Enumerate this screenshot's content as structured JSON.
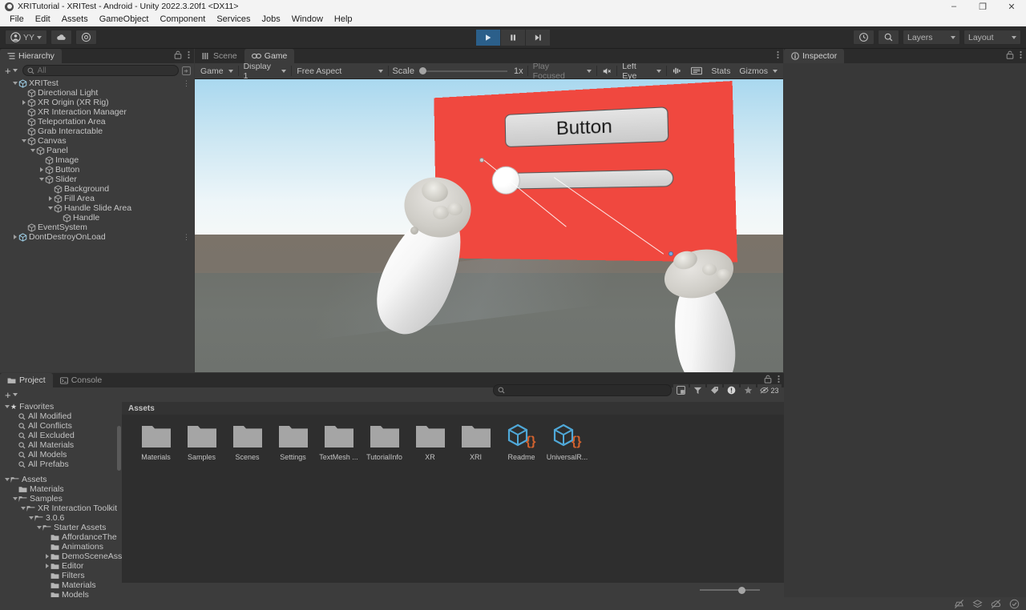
{
  "window": {
    "title": "XRITutorial - XRITest - Android - Unity 2022.3.20f1 <DX11>",
    "minimize": "–",
    "maximize": "❐",
    "close": "✕"
  },
  "menubar": {
    "items": [
      "File",
      "Edit",
      "Assets",
      "GameObject",
      "Component",
      "Services",
      "Jobs",
      "Window",
      "Help"
    ]
  },
  "toolbar": {
    "account_label": "YY",
    "cloud_icon": "cloud-icon",
    "settings_icon": "gear-icon",
    "play_icon": "play-icon",
    "pause_icon": "pause-icon",
    "step_icon": "step-icon",
    "undo_history_icon": "history-icon",
    "search_icon": "search-icon",
    "layers_label": "Layers",
    "layout_label": "Layout"
  },
  "hierarchy": {
    "tab_label": "Hierarchy",
    "add_label": "+",
    "search_placeholder": "All",
    "items": [
      {
        "label": "XRITest",
        "depth": 0,
        "twisty": "open",
        "icon": "prefab-icon",
        "more": true
      },
      {
        "label": "Directional Light",
        "depth": 1,
        "twisty": "none",
        "icon": "gameobject-icon",
        "more": false
      },
      {
        "label": "XR Origin (XR Rig)",
        "depth": 1,
        "twisty": "closed",
        "icon": "gameobject-icon",
        "more": false
      },
      {
        "label": "XR Interaction Manager",
        "depth": 1,
        "twisty": "none",
        "icon": "gameobject-icon",
        "more": false
      },
      {
        "label": "Teleportation Area",
        "depth": 1,
        "twisty": "none",
        "icon": "gameobject-icon",
        "more": false
      },
      {
        "label": "Grab Interactable",
        "depth": 1,
        "twisty": "none",
        "icon": "gameobject-icon",
        "more": false
      },
      {
        "label": "Canvas",
        "depth": 1,
        "twisty": "open",
        "icon": "gameobject-icon",
        "more": false
      },
      {
        "label": "Panel",
        "depth": 2,
        "twisty": "open",
        "icon": "gameobject-icon",
        "more": false
      },
      {
        "label": "Image",
        "depth": 3,
        "twisty": "none",
        "icon": "gameobject-icon",
        "more": false
      },
      {
        "label": "Button",
        "depth": 3,
        "twisty": "closed",
        "icon": "gameobject-icon",
        "more": false
      },
      {
        "label": "Slider",
        "depth": 3,
        "twisty": "open",
        "icon": "gameobject-icon",
        "more": false
      },
      {
        "label": "Background",
        "depth": 4,
        "twisty": "none",
        "icon": "gameobject-icon",
        "more": false
      },
      {
        "label": "Fill Area",
        "depth": 4,
        "twisty": "closed",
        "icon": "gameobject-icon",
        "more": false
      },
      {
        "label": "Handle Slide Area",
        "depth": 4,
        "twisty": "open",
        "icon": "gameobject-icon",
        "more": false
      },
      {
        "label": "Handle",
        "depth": 5,
        "twisty": "none",
        "icon": "gameobject-icon",
        "more": false
      },
      {
        "label": "EventSystem",
        "depth": 1,
        "twisty": "none",
        "icon": "gameobject-icon",
        "more": false
      },
      {
        "label": "DontDestroyOnLoad",
        "depth": 0,
        "twisty": "closed",
        "icon": "prefab-icon",
        "more": true
      }
    ]
  },
  "gameview": {
    "tabs": [
      {
        "label": "Scene",
        "icon": "scene-icon",
        "active": false
      },
      {
        "label": "Game",
        "icon": "game-icon",
        "active": true
      }
    ],
    "controls": {
      "target_display_label": "Game",
      "display_label": "Display 1",
      "aspect_label": "Free Aspect",
      "scale_label": "Scale",
      "scale_value": "1x",
      "play_focused_label": "Play Focused",
      "mute_icon": "mute-audio-icon",
      "eye_label": "Left Eye",
      "audio_icon": "audio-icon",
      "frame_debug_icon": "frame-debug-icon",
      "stats_label": "Stats",
      "gizmos_label": "Gizmos"
    },
    "scene": {
      "panel_color": "#f0483f",
      "button_label": "Button",
      "slider_value": 0,
      "controller_left": "vr-controller-left",
      "controller_right": "vr-controller-right"
    }
  },
  "inspector": {
    "tab_label": "Inspector"
  },
  "project": {
    "tabs": [
      {
        "label": "Project",
        "icon": "folder-icon",
        "active": true
      },
      {
        "label": "Console",
        "icon": "console-icon",
        "active": false
      }
    ],
    "add_label": "+",
    "search_placeholder": "",
    "search_value": "",
    "badge_count": "23",
    "breadcrumb": "Assets",
    "tree": [
      {
        "label": "Favorites",
        "depth": 0,
        "twisty": "open",
        "kind": "favorites"
      },
      {
        "label": "All Modified",
        "depth": 1,
        "twisty": "none",
        "kind": "search"
      },
      {
        "label": "All Conflicts",
        "depth": 1,
        "twisty": "none",
        "kind": "search"
      },
      {
        "label": "All Excluded",
        "depth": 1,
        "twisty": "none",
        "kind": "search"
      },
      {
        "label": "All Materials",
        "depth": 1,
        "twisty": "none",
        "kind": "search"
      },
      {
        "label": "All Models",
        "depth": 1,
        "twisty": "none",
        "kind": "search"
      },
      {
        "label": "All Prefabs",
        "depth": 1,
        "twisty": "none",
        "kind": "search"
      },
      {
        "label": "",
        "depth": 0,
        "twisty": "none",
        "kind": "spacer"
      },
      {
        "label": "Assets",
        "depth": 0,
        "twisty": "open",
        "kind": "folder-open"
      },
      {
        "label": "Materials",
        "depth": 1,
        "twisty": "none",
        "kind": "folder"
      },
      {
        "label": "Samples",
        "depth": 1,
        "twisty": "open",
        "kind": "folder-open"
      },
      {
        "label": "XR Interaction Toolkit",
        "depth": 2,
        "twisty": "open",
        "kind": "folder-open"
      },
      {
        "label": "3.0.6",
        "depth": 3,
        "twisty": "open",
        "kind": "folder-open"
      },
      {
        "label": "Starter Assets",
        "depth": 4,
        "twisty": "open",
        "kind": "folder-open"
      },
      {
        "label": "AffordanceThe",
        "depth": 5,
        "twisty": "none",
        "kind": "folder"
      },
      {
        "label": "Animations",
        "depth": 5,
        "twisty": "none",
        "kind": "folder"
      },
      {
        "label": "DemoSceneAss",
        "depth": 5,
        "twisty": "closed",
        "kind": "folder"
      },
      {
        "label": "Editor",
        "depth": 5,
        "twisty": "closed",
        "kind": "folder"
      },
      {
        "label": "Filters",
        "depth": 5,
        "twisty": "none",
        "kind": "folder"
      },
      {
        "label": "Materials",
        "depth": 5,
        "twisty": "none",
        "kind": "folder"
      },
      {
        "label": "Models",
        "depth": 5,
        "twisty": "none",
        "kind": "folder"
      }
    ],
    "assets": [
      {
        "label": "Materials",
        "type": "folder"
      },
      {
        "label": "Samples",
        "type": "folder"
      },
      {
        "label": "Scenes",
        "type": "folder"
      },
      {
        "label": "Settings",
        "type": "folder"
      },
      {
        "label": "TextMesh ...",
        "type": "folder"
      },
      {
        "label": "TutorialInfo",
        "type": "folder"
      },
      {
        "label": "XR",
        "type": "folder"
      },
      {
        "label": "XRI",
        "type": "folder"
      },
      {
        "label": "Readme",
        "type": "asset"
      },
      {
        "label": "UniversalR...",
        "type": "asset"
      }
    ]
  },
  "statusbar": {
    "icons": [
      "no-collab-icon",
      "layers-stack-icon",
      "no-cloud-icon",
      "check-icon"
    ]
  }
}
